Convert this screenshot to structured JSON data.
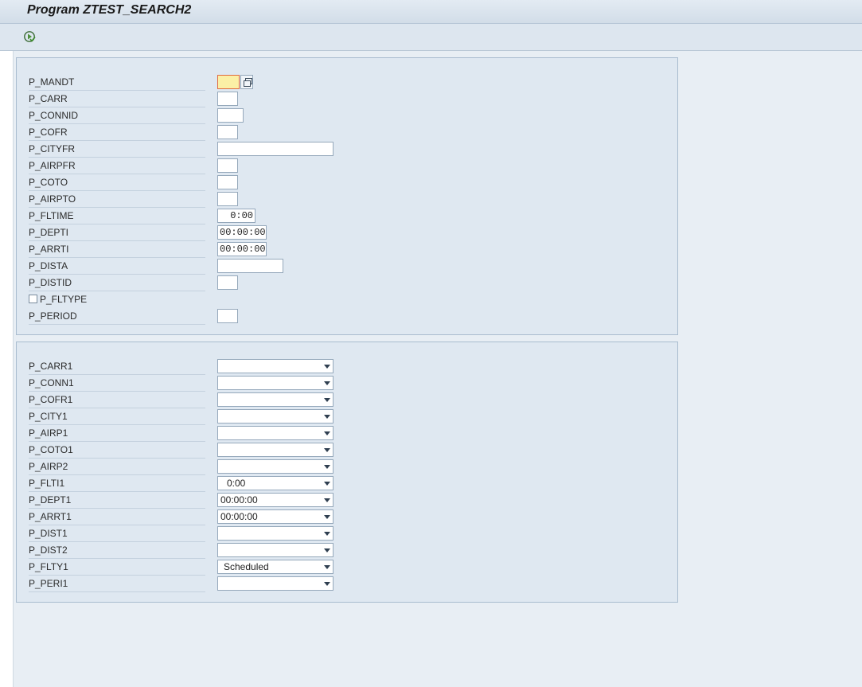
{
  "window": {
    "title": "Program ZTEST_SEARCH2"
  },
  "toolbar": {
    "execute_icon": "execute-icon"
  },
  "block1": {
    "fields": [
      {
        "label": "P_MANDT",
        "value": ""
      },
      {
        "label": "P_CARR",
        "value": ""
      },
      {
        "label": "P_CONNID",
        "value": ""
      },
      {
        "label": "P_COFR",
        "value": ""
      },
      {
        "label": "P_CITYFR",
        "value": ""
      },
      {
        "label": "P_AIRPFR",
        "value": ""
      },
      {
        "label": "P_COTO",
        "value": ""
      },
      {
        "label": "P_AIRPTO",
        "value": ""
      },
      {
        "label": "P_FLTIME",
        "value": "0:00"
      },
      {
        "label": "P_DEPTI",
        "value": "00:00:00"
      },
      {
        "label": "P_ARRTI",
        "value": "00:00:00"
      },
      {
        "label": "P_DISTA",
        "value": ""
      },
      {
        "label": "P_DISTID",
        "value": ""
      },
      {
        "label": "P_FLTYPE",
        "value": ""
      },
      {
        "label": "P_PERIOD",
        "value": ""
      }
    ]
  },
  "block2": {
    "fields": [
      {
        "label": "P_CARR1",
        "value": ""
      },
      {
        "label": "P_CONN1",
        "value": ""
      },
      {
        "label": "P_COFR1",
        "value": ""
      },
      {
        "label": "P_CITY1",
        "value": ""
      },
      {
        "label": "P_AIRP1",
        "value": ""
      },
      {
        "label": "P_COTO1",
        "value": ""
      },
      {
        "label": "P_AIRP2",
        "value": ""
      },
      {
        "label": "P_FLTI1",
        "value": "0:00"
      },
      {
        "label": "P_DEPT1",
        "value": "00:00:00"
      },
      {
        "label": "P_ARRT1",
        "value": "00:00:00"
      },
      {
        "label": "P_DIST1",
        "value": ""
      },
      {
        "label": "P_DIST2",
        "value": ""
      },
      {
        "label": "P_FLTY1",
        "value": "Scheduled"
      },
      {
        "label": "P_PERI1",
        "value": ""
      }
    ]
  }
}
